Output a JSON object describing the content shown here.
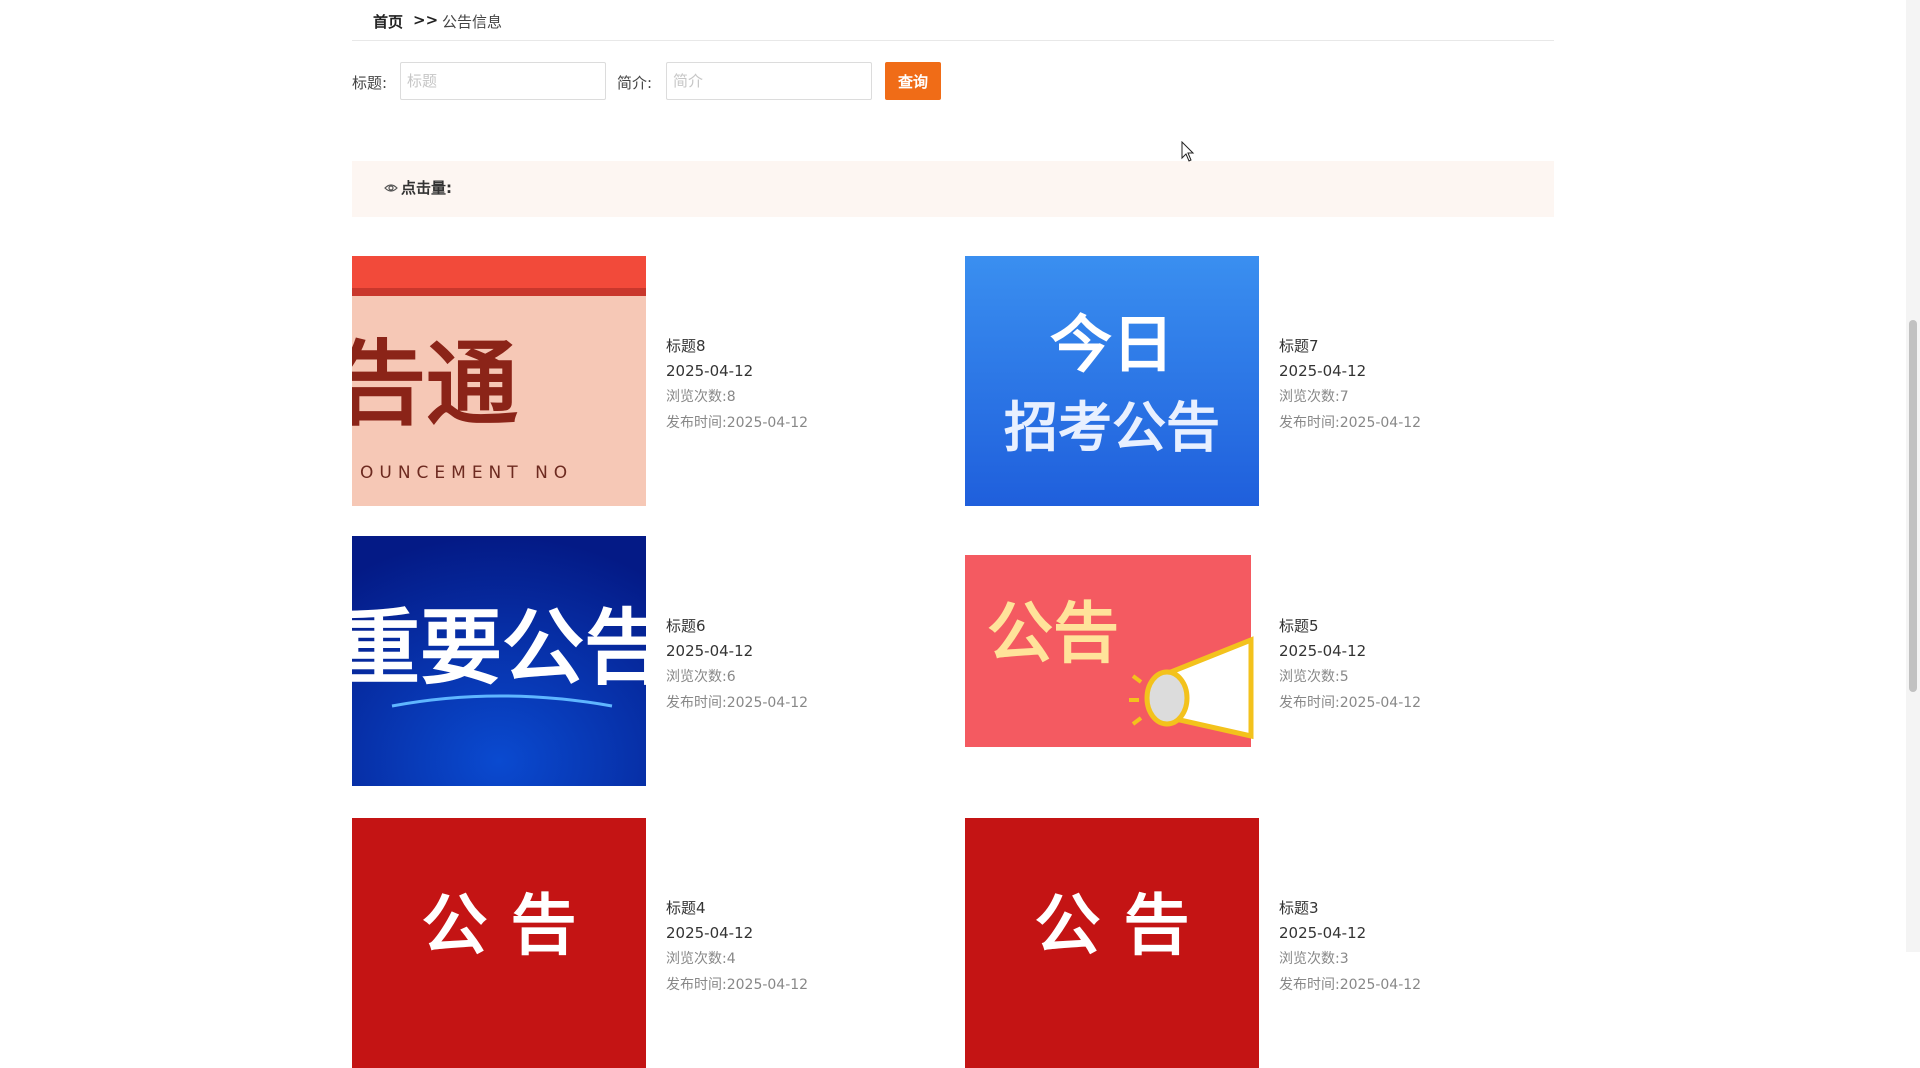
{
  "breadcrumb": {
    "home": "首页",
    "separator": ">>",
    "current": "公告信息"
  },
  "search": {
    "title_label": "标题:",
    "title_placeholder": "标题",
    "intro_label": "简介:",
    "intro_placeholder": "简介",
    "query_button": "查询"
  },
  "sort": {
    "clicks_label": "点击量:"
  },
  "cards": [
    {
      "title": "标题8",
      "date": "2025-04-12",
      "views_label": "浏览次数:",
      "views": "8",
      "publish_label": "发布时间:",
      "publish": "2025-04-12",
      "image_text": "告通",
      "image_sub": "OUNCEMENT  NO"
    },
    {
      "title": "标题7",
      "date": "2025-04-12",
      "views_label": "浏览次数:",
      "views": "7",
      "publish_label": "发布时间:",
      "publish": "2025-04-12",
      "image_text_1": "今日",
      "image_text_2": "招考公告"
    },
    {
      "title": "标题6",
      "date": "2025-04-12",
      "views_label": "浏览次数:",
      "views": "6",
      "publish_label": "发布时间:",
      "publish": "2025-04-12",
      "image_text": "重要公告"
    },
    {
      "title": "标题5",
      "date": "2025-04-12",
      "views_label": "浏览次数:",
      "views": "5",
      "publish_label": "发布时间:",
      "publish": "2025-04-12",
      "image_text": "公告"
    },
    {
      "title": "标题4",
      "date": "2025-04-12",
      "views_label": "浏览次数:",
      "views": "4",
      "publish_label": "发布时间:",
      "publish": "2025-04-12",
      "image_text": "公 告"
    },
    {
      "title": "标题3",
      "date": "2025-04-12",
      "views_label": "浏览次数:",
      "views": "3",
      "publish_label": "发布时间:",
      "publish": "2025-04-12",
      "image_text": "公 告"
    }
  ],
  "colors": {
    "accent": "#f06c17",
    "sortbar_bg": "#fdf6f2"
  },
  "icons": {
    "sort": "eye-icon"
  }
}
